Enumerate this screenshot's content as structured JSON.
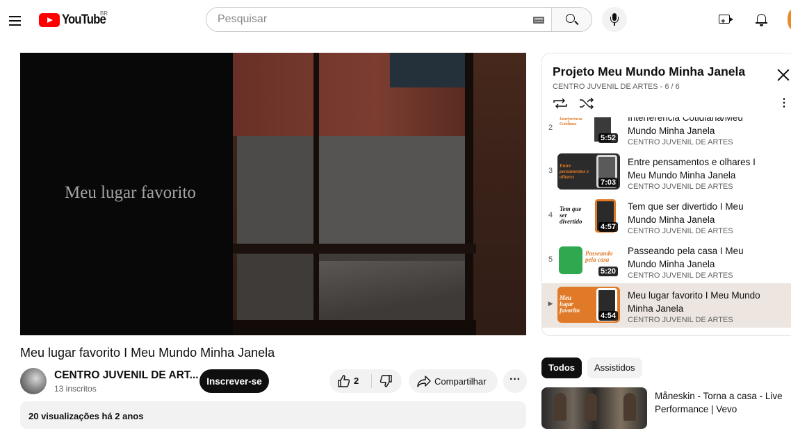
{
  "header": {
    "logo_text": "YouTube",
    "logo_region": "BR",
    "search_placeholder": "Pesquisar"
  },
  "video": {
    "caption": "Meu lugar favorito",
    "title": "Meu lugar favorito I Meu Mundo Minha Janela"
  },
  "channel": {
    "name": "CENTRO JUVENIL DE ART...",
    "subscribers": "13 inscritos",
    "subscribe_label": "Inscrever-se"
  },
  "actions": {
    "like_count": "2",
    "share_label": "Compartilhar",
    "more_label": "···"
  },
  "description": {
    "meta": "20 visualizações  há 2 anos"
  },
  "playlist": {
    "title": "Projeto Meu Mundo Minha Janela",
    "subtitle": "CENTRO JUVENIL DE ARTES - 6 / 6",
    "items": [
      {
        "index": "2",
        "title": "Interferência Cotidiana/Meu Mundo Minha Janela",
        "channel": "CENTRO JUVENIL DE ARTES",
        "duration": "5:52",
        "thumb_text": "Interferência Cotidiana",
        "active": false
      },
      {
        "index": "3",
        "title": "Entre pensamentos e olhares I Meu Mundo Minha Janela",
        "channel": "CENTRO JUVENIL DE ARTES",
        "duration": "7:03",
        "thumb_text": "Entre pensamentos e olhares",
        "active": false
      },
      {
        "index": "4",
        "title": "Tem que ser divertido I Meu Mundo Minha Janela",
        "channel": "CENTRO JUVENIL DE ARTES",
        "duration": "4:57",
        "thumb_text": "Tem que ser divertido",
        "active": false
      },
      {
        "index": "5",
        "title": "Passeando pela casa I Meu Mundo Minha Janela",
        "channel": "CENTRO JUVENIL DE ARTES",
        "duration": "5:20",
        "thumb_text": "Passeando pela casa",
        "active": false
      },
      {
        "index": "▶",
        "title": "Meu lugar favorito I Meu Mundo Minha Janela",
        "channel": "CENTRO JUVENIL DE ARTES",
        "duration": "4:54",
        "thumb_text": "Meu lugar favorito",
        "active": true
      }
    ]
  },
  "chips": {
    "all": "Todos",
    "watched": "Assistidos"
  },
  "recommendation": {
    "title": "Måneskin - Torna a casa - Live Performance | Vevo"
  },
  "colors": {
    "brand_red": "#ff0000",
    "accent_orange": "#e07a28",
    "active_row": "#ede6e0"
  },
  "icons": [
    "menu-icon",
    "search-icon",
    "keyboard-icon",
    "mic-icon",
    "create-icon",
    "bell-icon",
    "close-icon",
    "loop-icon",
    "shuffle-icon",
    "kebab-icon",
    "like-icon",
    "dislike-icon",
    "share-icon"
  ]
}
